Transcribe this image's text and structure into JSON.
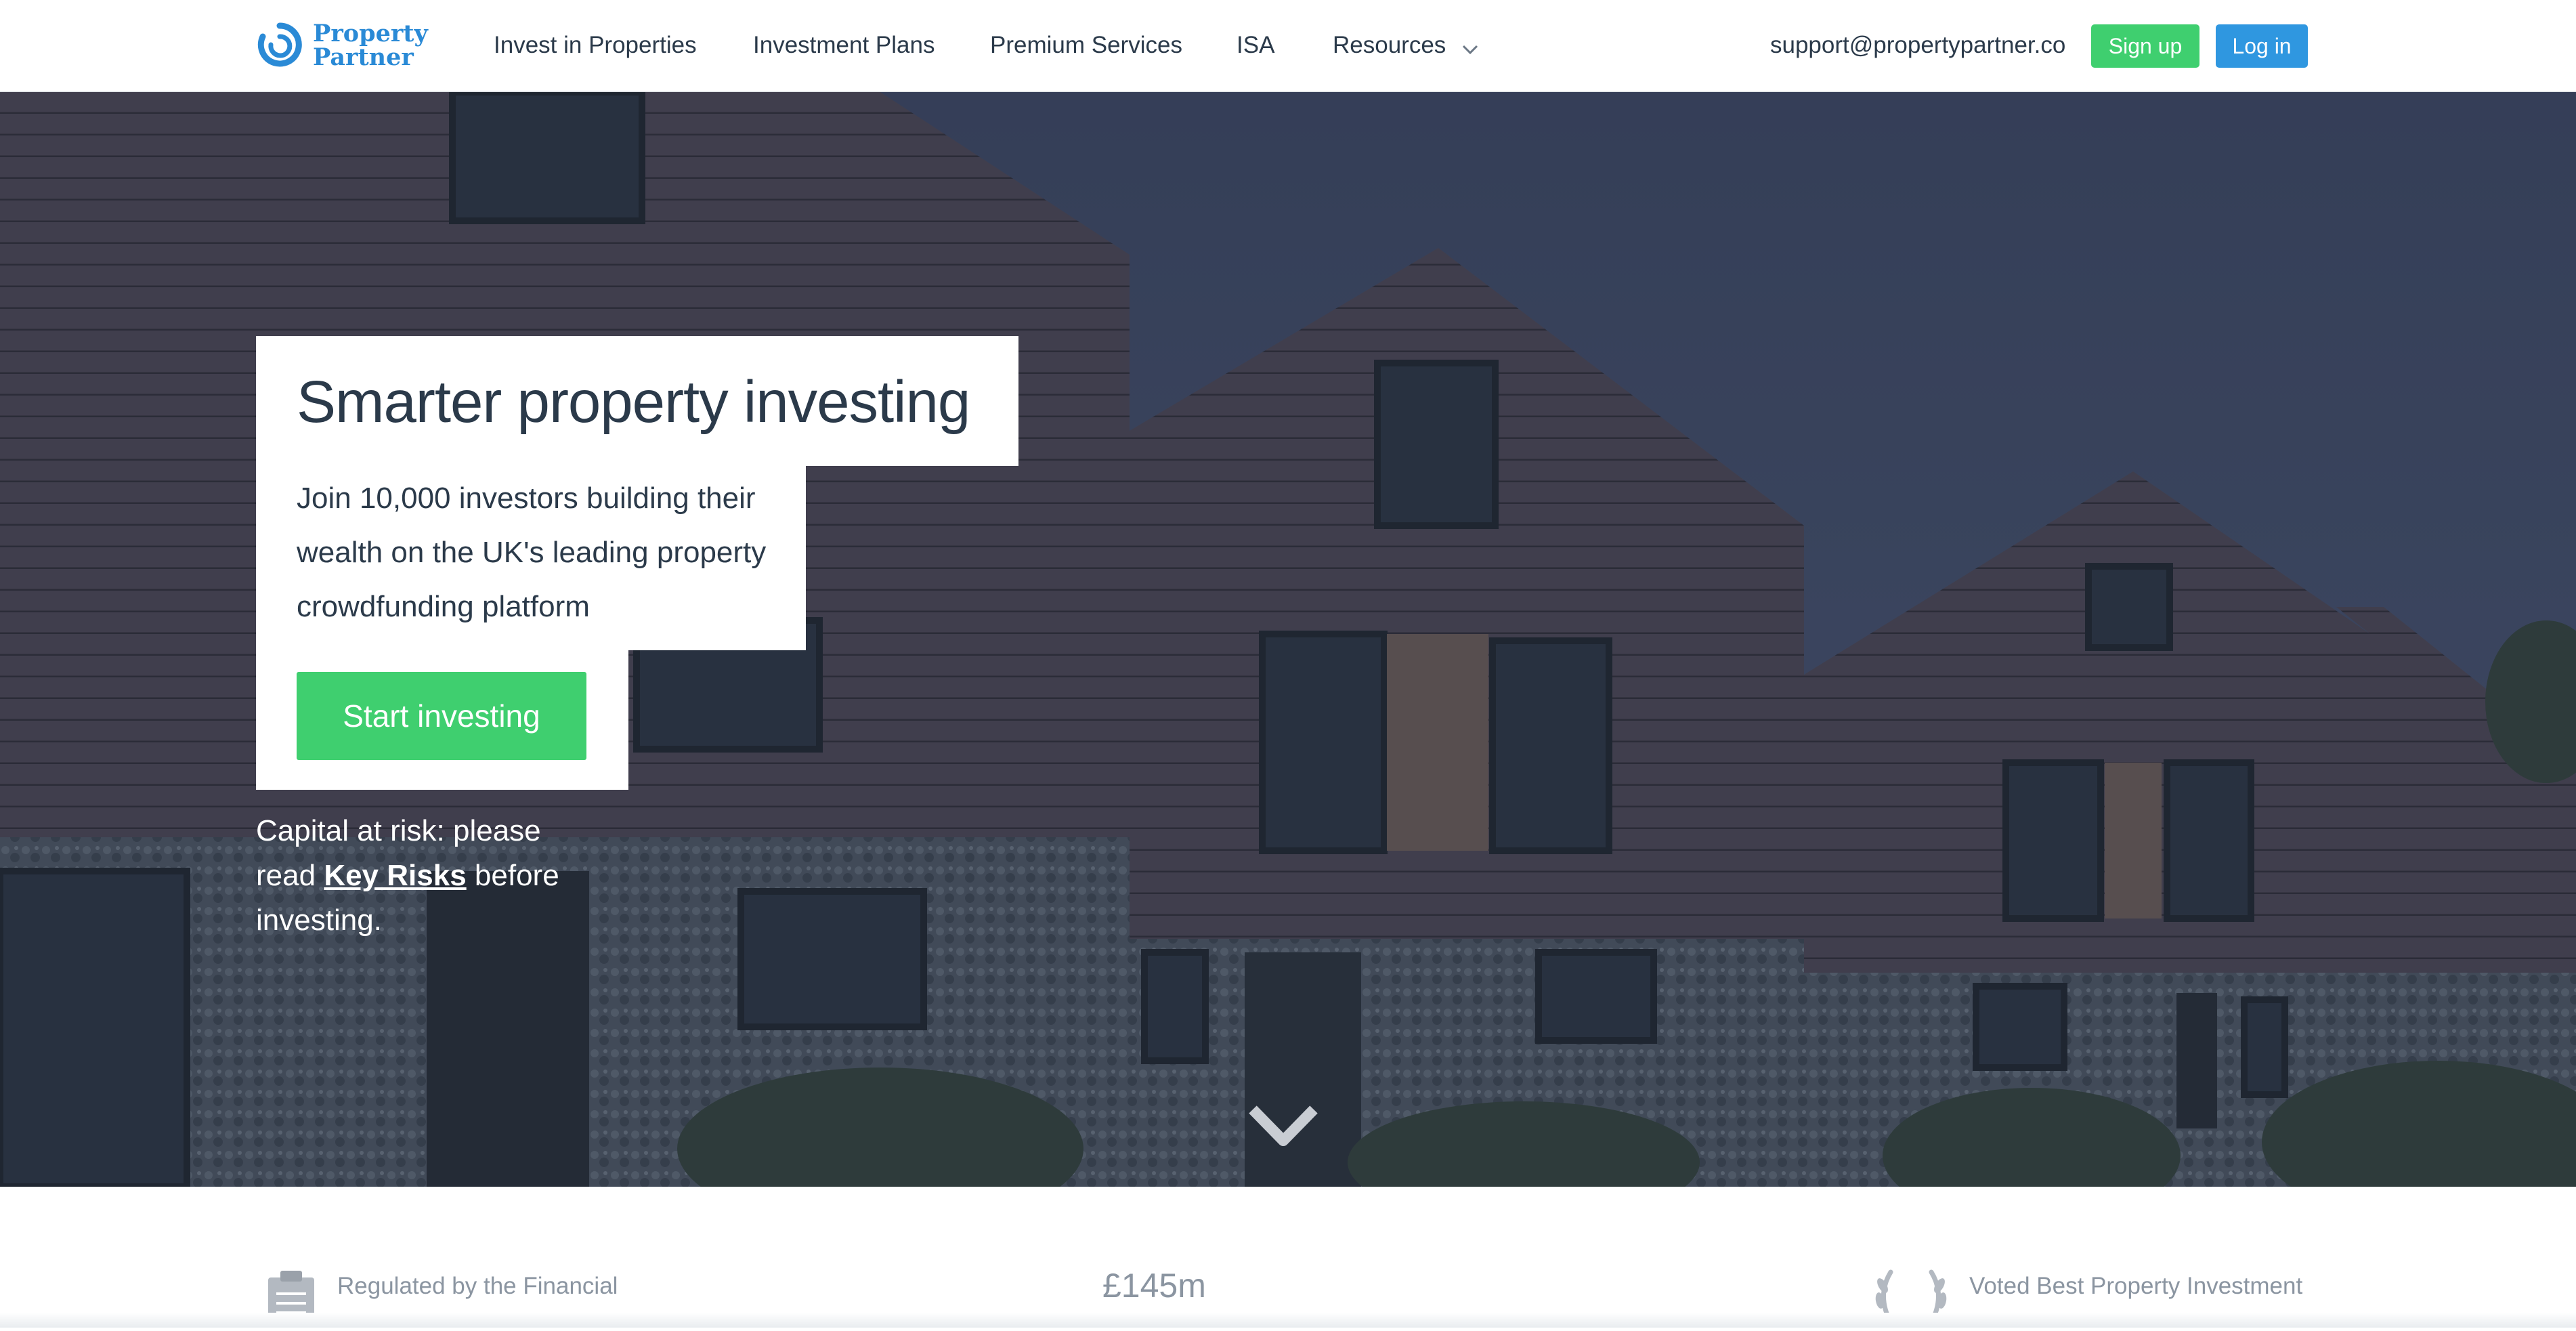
{
  "brand": {
    "name_line1": "Property",
    "name_line2": "Partner",
    "logo_color": "#2a8ad6"
  },
  "nav": {
    "items": [
      {
        "label": "Invest in Properties"
      },
      {
        "label": "Investment Plans"
      },
      {
        "label": "Premium Services"
      },
      {
        "label": "ISA"
      },
      {
        "label": "Resources",
        "icon": "chevron-down-icon"
      }
    ],
    "support_email": "support@propertypartner.co",
    "signup_label": "Sign up",
    "login_label": "Log in"
  },
  "hero": {
    "title": "Smarter property investing",
    "subtitle": "Join 10,000 investors building their wealth on the UK's leading property crowdfunding platform",
    "cta_label": "Start investing",
    "risk_prefix": "Capital at risk: please read",
    "risk_link": "Key Risks",
    "risk_suffix": "before investing.",
    "scroll_icon": "chevron-down-icon"
  },
  "stats": {
    "regulated_text": "Regulated by the Financial",
    "amount": "£145m",
    "award_text": "Voted Best Property Investment"
  },
  "colors": {
    "accent_green": "#3fcf6f",
    "accent_blue": "#2f97e0",
    "text_dark": "#2b3a4a",
    "text_muted": "#8b95a1"
  }
}
